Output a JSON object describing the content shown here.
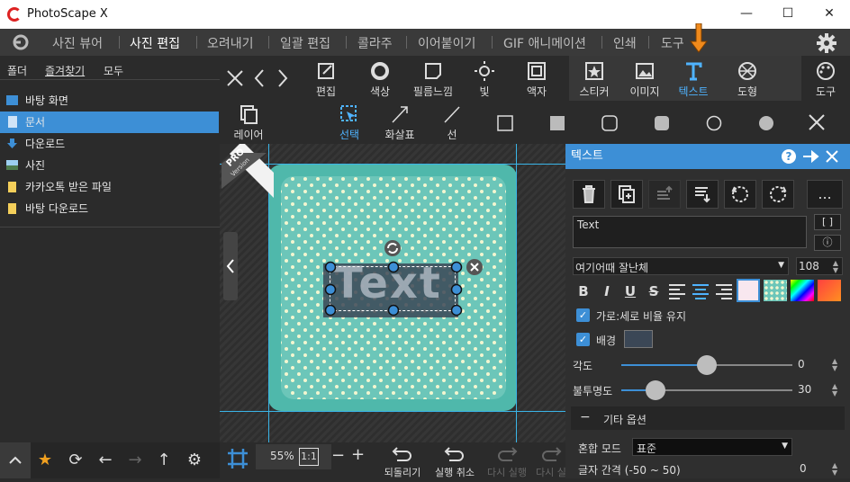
{
  "window": {
    "title": "PhotoScape X",
    "minimize": "—",
    "maximize": "☐",
    "close": "✕"
  },
  "menu": {
    "items": [
      {
        "label": "사진 뷰어",
        "active": false
      },
      {
        "label": "사진 편집",
        "active": true
      },
      {
        "label": "오려내기",
        "active": false
      },
      {
        "label": "일괄 편집",
        "active": false
      },
      {
        "label": "콜라주",
        "active": false
      },
      {
        "label": "이어붙이기",
        "active": false
      },
      {
        "label": "GIF 애니메이션",
        "active": false
      },
      {
        "label": "인쇄",
        "active": false
      },
      {
        "label": "도구",
        "active": false
      }
    ]
  },
  "left_panel": {
    "tabs": [
      "폴더",
      "즐겨찾기",
      "모두"
    ],
    "items": [
      {
        "label": "바탕 화면",
        "icon": "desktop-icon",
        "selected": false
      },
      {
        "label": "문서",
        "icon": "document-icon",
        "selected": true
      },
      {
        "label": "다운로드",
        "icon": "download-icon",
        "selected": false
      },
      {
        "label": "사진",
        "icon": "picture-icon",
        "selected": false
      },
      {
        "label": "카카오톡 받은 파일",
        "icon": "folder-icon",
        "selected": false
      },
      {
        "label": "바탕 다운로드",
        "icon": "folder-icon",
        "selected": false
      }
    ]
  },
  "toolbar_main": {
    "tools": [
      {
        "label": "편집",
        "icon": "edit-icon"
      },
      {
        "label": "색상",
        "icon": "color-icon"
      },
      {
        "label": "필름느낌",
        "icon": "film-icon"
      },
      {
        "label": "빛",
        "icon": "light-icon"
      },
      {
        "label": "액자",
        "icon": "frame-icon"
      },
      {
        "label": "스티커",
        "icon": "sticker-icon"
      },
      {
        "label": "이미지",
        "icon": "image-icon"
      },
      {
        "label": "텍스트",
        "icon": "text-icon",
        "active": true
      },
      {
        "label": "도형",
        "icon": "shape-icon"
      },
      {
        "label": "도구",
        "icon": "palette-icon"
      }
    ]
  },
  "toolbar_sub": {
    "tools": [
      {
        "label": "레이어",
        "icon": "layers-icon"
      },
      {
        "label": "선택",
        "icon": "select-icon",
        "active": true
      },
      {
        "label": "화살표",
        "icon": "arrow-icon"
      },
      {
        "label": "선",
        "icon": "line-icon"
      }
    ]
  },
  "canvas": {
    "sample_text": "Text",
    "badge_pro": "PRO",
    "badge_version": "Version"
  },
  "bottom": {
    "zoom": "55%",
    "ratio": "1:1",
    "undo_all": "되돌리기",
    "undo": "실행 취소",
    "redo": "다시 실행",
    "redo_all": "다시 실"
  },
  "text_panel": {
    "title": "텍스트",
    "text_value": "Text",
    "bracket_btn": "[ ]",
    "info_btn": "ⓘ",
    "more_btn": "...",
    "font": "여기어때 잘난체",
    "font_size": "108",
    "keep_ratio_label": "가로:세로 비율 유지",
    "background_label": "배경",
    "angle_label": "각도",
    "angle_value": "0",
    "angle_fraction": 0.5,
    "opacity_label": "불투명도",
    "opacity_value": "30",
    "opacity_fraction": 0.2,
    "other_options": "기타 옵션",
    "blend_label": "혼합 모드",
    "blend_value": "표준",
    "spacing_label": "글자 간격 (-50 ~ 50)",
    "spacing_value": "0",
    "background_color": "#3b4756",
    "accent": "#3d8fd6"
  }
}
